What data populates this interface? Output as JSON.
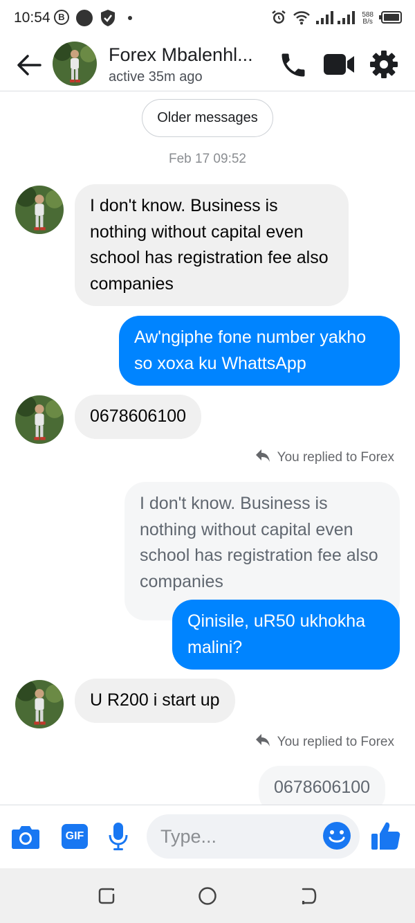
{
  "status_bar": {
    "time": "10:54",
    "b_badge": "B",
    "net_speed_value": "588",
    "net_speed_unit": "B/s"
  },
  "header": {
    "contact_name": "Forex Mbalenhl...",
    "active_status": "active 35m ago"
  },
  "thread": {
    "older_messages_label": "Older messages",
    "date_stamp": "Feb 17 09:52",
    "messages": [
      {
        "from": "them",
        "text": "I don't know. Business is nothing without capital even school has registration fee also companies"
      },
      {
        "from": "me",
        "text": "Aw'ngiphe fone number yakho so xoxa ku WhattsApp"
      },
      {
        "from": "them",
        "text": "0678606100"
      },
      {
        "reply_label": "You replied to Forex",
        "quoted": "I don't know. Business is nothing without capital even school has registration fee also companies",
        "from": "me",
        "text": "Qinisile, uR50 ukhokha malini?"
      },
      {
        "from": "them",
        "text": "U R200 i start up"
      },
      {
        "reply_label": "You replied to Forex",
        "quoted": "0678606100"
      }
    ]
  },
  "composer": {
    "placeholder": "Type...",
    "gif_label": "GIF"
  },
  "colors": {
    "accent": "#0084ff",
    "incoming_bubble": "#f0f0f0",
    "icon_dark": "#333333",
    "icon_blue": "#1877f2"
  },
  "icons": [
    "back-arrow-icon",
    "phone-icon",
    "video-camera-icon",
    "gear-icon",
    "reply-arrow-icon",
    "camera-icon",
    "gif-icon",
    "microphone-icon",
    "emoji-icon",
    "thumbs-up-icon",
    "alarm-icon",
    "wifi-icon",
    "signal-icon",
    "battery-icon"
  ]
}
